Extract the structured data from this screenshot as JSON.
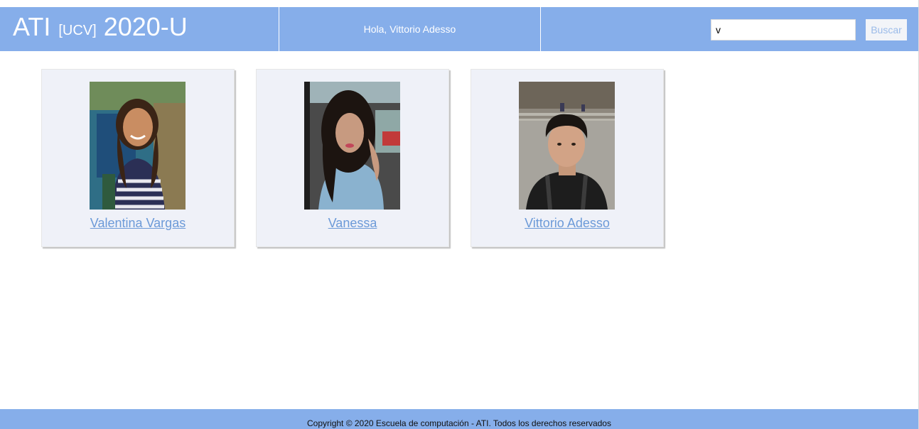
{
  "header": {
    "brand_main": "ATI",
    "brand_sub": "[UCV]",
    "brand_year": "2020-U",
    "greeting": "Hola, Vittorio Adesso"
  },
  "search": {
    "value": "v",
    "button_label": "Buscar"
  },
  "results": [
    {
      "name": "Valentina Vargas"
    },
    {
      "name": "Vanessa"
    },
    {
      "name": "Vittorio Adesso"
    }
  ],
  "footer": {
    "text": "Copyright © 2020 Escuela de computación - ATI. Todos los derechos reservados"
  }
}
